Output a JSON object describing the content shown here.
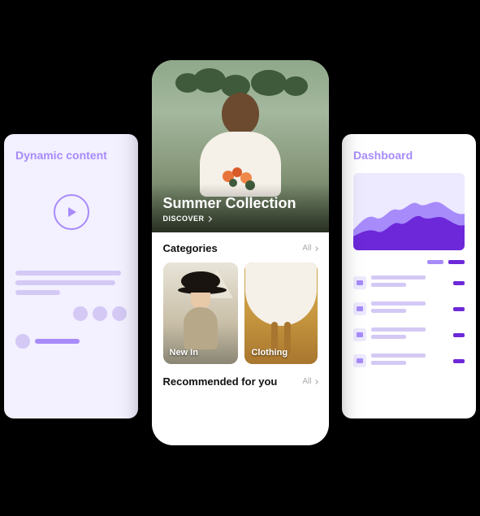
{
  "left_card": {
    "title": "Dynamic content"
  },
  "right_card": {
    "title": "Dashboard"
  },
  "phone": {
    "hero": {
      "title": "Summer Collection",
      "cta": "DISCOVER"
    },
    "categories": {
      "title": "Categories",
      "all": "All",
      "items": [
        {
          "label": "New In"
        },
        {
          "label": "Clothing"
        }
      ]
    },
    "recommended": {
      "title": "Recommended for you",
      "all": "All"
    }
  }
}
